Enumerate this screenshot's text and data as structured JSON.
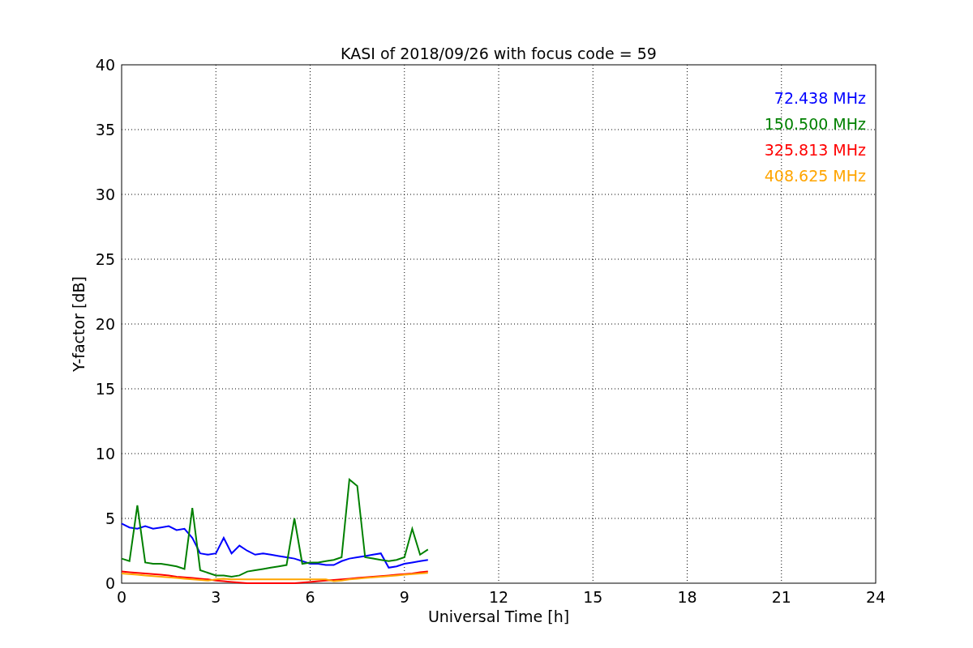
{
  "chart_data": {
    "type": "line",
    "title": "KASI of 2018/09/26 with focus code = 59",
    "xlabel": "Universal Time [h]",
    "ylabel": "Y-factor [dB]",
    "x": [
      0,
      0.25,
      0.5,
      0.75,
      1,
      1.25,
      1.5,
      1.75,
      2,
      2.25,
      2.5,
      2.75,
      3,
      3.25,
      3.5,
      3.75,
      4,
      4.25,
      4.5,
      4.75,
      5,
      5.25,
      5.5,
      5.75,
      6,
      6.25,
      6.5,
      6.75,
      7,
      7.25,
      7.5,
      7.75,
      8,
      8.25,
      8.5,
      8.75,
      9,
      9.25,
      9.5,
      9.75
    ],
    "series": [
      {
        "name": "72.438 MHz",
        "color": "#0000ff",
        "values": [
          4.6,
          4.3,
          4.2,
          4.4,
          4.2,
          4.3,
          4.4,
          4.1,
          4.2,
          3.5,
          2.3,
          2.2,
          2.3,
          3.5,
          2.3,
          2.9,
          2.5,
          2.2,
          2.3,
          2.2,
          2.1,
          2.0,
          1.9,
          1.7,
          1.5,
          1.5,
          1.4,
          1.4,
          1.7,
          1.9,
          2.0,
          2.1,
          2.2,
          2.3,
          1.2,
          1.3,
          1.5,
          1.6,
          1.7,
          1.8
        ]
      },
      {
        "name": "150.500 MHz",
        "color": "#008000",
        "values": [
          1.9,
          1.7,
          6.0,
          1.6,
          1.5,
          1.5,
          1.4,
          1.3,
          1.1,
          5.8,
          1.0,
          0.8,
          0.6,
          0.6,
          0.5,
          0.6,
          0.9,
          1.0,
          1.1,
          1.2,
          1.3,
          1.4,
          5.0,
          1.5,
          1.6,
          1.6,
          1.7,
          1.8,
          2.0,
          8.0,
          7.5,
          2.0,
          1.9,
          1.8,
          1.7,
          1.8,
          2.0,
          4.2,
          2.2,
          2.6
        ]
      },
      {
        "name": "325.813 MHz",
        "color": "#ff0000",
        "values": [
          0.9,
          0.85,
          0.8,
          0.75,
          0.7,
          0.65,
          0.6,
          0.5,
          0.45,
          0.4,
          0.35,
          0.3,
          0.2,
          0.15,
          0.1,
          0.05,
          0.0,
          0.0,
          0.0,
          0.0,
          0.0,
          0.0,
          0.0,
          0.05,
          0.1,
          0.15,
          0.2,
          0.25,
          0.3,
          0.35,
          0.4,
          0.45,
          0.5,
          0.55,
          0.6,
          0.65,
          0.7,
          0.75,
          0.85,
          0.9
        ]
      },
      {
        "name": "408.625 MHz",
        "color": "#ffa500",
        "values": [
          0.75,
          0.7,
          0.65,
          0.6,
          0.55,
          0.5,
          0.45,
          0.4,
          0.35,
          0.3,
          0.25,
          0.2,
          0.3,
          0.35,
          0.3,
          0.3,
          0.3,
          0.3,
          0.3,
          0.3,
          0.3,
          0.3,
          0.3,
          0.3,
          0.3,
          0.3,
          0.3,
          0.15,
          0.2,
          0.3,
          0.35,
          0.4,
          0.45,
          0.5,
          0.55,
          0.6,
          0.65,
          0.7,
          0.75,
          0.8
        ]
      }
    ],
    "xlim": [
      0,
      24
    ],
    "ylim": [
      0,
      40
    ],
    "xticks": [
      0,
      3,
      6,
      9,
      12,
      15,
      18,
      21,
      24
    ],
    "yticks": [
      0,
      5,
      10,
      15,
      20,
      25,
      30,
      35,
      40
    ],
    "grid": true
  }
}
